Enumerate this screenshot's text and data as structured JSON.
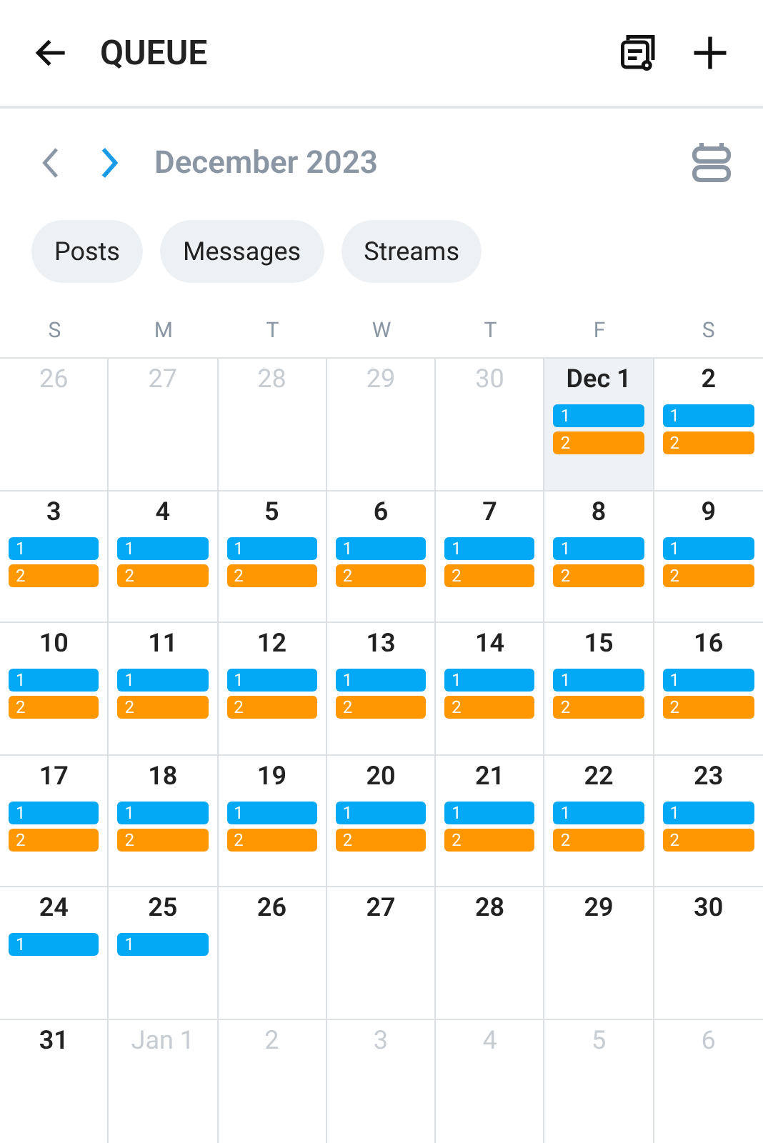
{
  "header": {
    "title": "QUEUE"
  },
  "nav": {
    "month": "December 2023"
  },
  "filters": [
    {
      "label": "Posts"
    },
    {
      "label": "Messages"
    },
    {
      "label": "Streams"
    }
  ],
  "weekdays": [
    "S",
    "M",
    "T",
    "W",
    "T",
    "F",
    "S"
  ],
  "weeks": [
    [
      {
        "label": "26",
        "outside": true,
        "selected": false
      },
      {
        "label": "27",
        "outside": true,
        "selected": false
      },
      {
        "label": "28",
        "outside": true,
        "selected": false
      },
      {
        "label": "29",
        "outside": true,
        "selected": false
      },
      {
        "label": "30",
        "outside": true,
        "selected": false
      },
      {
        "label": "Dec 1",
        "outside": false,
        "selected": true,
        "events": [
          {
            "label": "1",
            "color": "#03a9f4"
          },
          {
            "label": "2",
            "color": "#ff9800"
          }
        ]
      },
      {
        "label": "2",
        "outside": false,
        "selected": false,
        "events": [
          {
            "label": "1",
            "color": "#03a9f4"
          },
          {
            "label": "2",
            "color": "#ff9800"
          }
        ]
      }
    ],
    [
      {
        "label": "3",
        "outside": false,
        "selected": false,
        "events": [
          {
            "label": "1",
            "color": "#03a9f4"
          },
          {
            "label": "2",
            "color": "#ff9800"
          }
        ]
      },
      {
        "label": "4",
        "outside": false,
        "selected": false,
        "events": [
          {
            "label": "1",
            "color": "#03a9f4"
          },
          {
            "label": "2",
            "color": "#ff9800"
          }
        ]
      },
      {
        "label": "5",
        "outside": false,
        "selected": false,
        "events": [
          {
            "label": "1",
            "color": "#03a9f4"
          },
          {
            "label": "2",
            "color": "#ff9800"
          }
        ]
      },
      {
        "label": "6",
        "outside": false,
        "selected": false,
        "events": [
          {
            "label": "1",
            "color": "#03a9f4"
          },
          {
            "label": "2",
            "color": "#ff9800"
          }
        ]
      },
      {
        "label": "7",
        "outside": false,
        "selected": false,
        "events": [
          {
            "label": "1",
            "color": "#03a9f4"
          },
          {
            "label": "2",
            "color": "#ff9800"
          }
        ]
      },
      {
        "label": "8",
        "outside": false,
        "selected": false,
        "events": [
          {
            "label": "1",
            "color": "#03a9f4"
          },
          {
            "label": "2",
            "color": "#ff9800"
          }
        ]
      },
      {
        "label": "9",
        "outside": false,
        "selected": false,
        "events": [
          {
            "label": "1",
            "color": "#03a9f4"
          },
          {
            "label": "2",
            "color": "#ff9800"
          }
        ]
      }
    ],
    [
      {
        "label": "10",
        "outside": false,
        "selected": false,
        "events": [
          {
            "label": "1",
            "color": "#03a9f4"
          },
          {
            "label": "2",
            "color": "#ff9800"
          }
        ]
      },
      {
        "label": "11",
        "outside": false,
        "selected": false,
        "events": [
          {
            "label": "1",
            "color": "#03a9f4"
          },
          {
            "label": "2",
            "color": "#ff9800"
          }
        ]
      },
      {
        "label": "12",
        "outside": false,
        "selected": false,
        "events": [
          {
            "label": "1",
            "color": "#03a9f4"
          },
          {
            "label": "2",
            "color": "#ff9800"
          }
        ]
      },
      {
        "label": "13",
        "outside": false,
        "selected": false,
        "events": [
          {
            "label": "1",
            "color": "#03a9f4"
          },
          {
            "label": "2",
            "color": "#ff9800"
          }
        ]
      },
      {
        "label": "14",
        "outside": false,
        "selected": false,
        "events": [
          {
            "label": "1",
            "color": "#03a9f4"
          },
          {
            "label": "2",
            "color": "#ff9800"
          }
        ]
      },
      {
        "label": "15",
        "outside": false,
        "selected": false,
        "events": [
          {
            "label": "1",
            "color": "#03a9f4"
          },
          {
            "label": "2",
            "color": "#ff9800"
          }
        ]
      },
      {
        "label": "16",
        "outside": false,
        "selected": false,
        "events": [
          {
            "label": "1",
            "color": "#03a9f4"
          },
          {
            "label": "2",
            "color": "#ff9800"
          }
        ]
      }
    ],
    [
      {
        "label": "17",
        "outside": false,
        "selected": false,
        "events": [
          {
            "label": "1",
            "color": "#03a9f4"
          },
          {
            "label": "2",
            "color": "#ff9800"
          }
        ]
      },
      {
        "label": "18",
        "outside": false,
        "selected": false,
        "events": [
          {
            "label": "1",
            "color": "#03a9f4"
          },
          {
            "label": "2",
            "color": "#ff9800"
          }
        ]
      },
      {
        "label": "19",
        "outside": false,
        "selected": false,
        "events": [
          {
            "label": "1",
            "color": "#03a9f4"
          },
          {
            "label": "2",
            "color": "#ff9800"
          }
        ]
      },
      {
        "label": "20",
        "outside": false,
        "selected": false,
        "events": [
          {
            "label": "1",
            "color": "#03a9f4"
          },
          {
            "label": "2",
            "color": "#ff9800"
          }
        ]
      },
      {
        "label": "21",
        "outside": false,
        "selected": false,
        "events": [
          {
            "label": "1",
            "color": "#03a9f4"
          },
          {
            "label": "2",
            "color": "#ff9800"
          }
        ]
      },
      {
        "label": "22",
        "outside": false,
        "selected": false,
        "events": [
          {
            "label": "1",
            "color": "#03a9f4"
          },
          {
            "label": "2",
            "color": "#ff9800"
          }
        ]
      },
      {
        "label": "23",
        "outside": false,
        "selected": false,
        "events": [
          {
            "label": "1",
            "color": "#03a9f4"
          },
          {
            "label": "2",
            "color": "#ff9800"
          }
        ]
      }
    ],
    [
      {
        "label": "24",
        "outside": false,
        "selected": false,
        "events": [
          {
            "label": "1",
            "color": "#03a9f4"
          }
        ]
      },
      {
        "label": "25",
        "outside": false,
        "selected": false,
        "events": [
          {
            "label": "1",
            "color": "#03a9f4"
          }
        ]
      },
      {
        "label": "26",
        "outside": false,
        "selected": false
      },
      {
        "label": "27",
        "outside": false,
        "selected": false
      },
      {
        "label": "28",
        "outside": false,
        "selected": false
      },
      {
        "label": "29",
        "outside": false,
        "selected": false
      },
      {
        "label": "30",
        "outside": false,
        "selected": false
      }
    ],
    [
      {
        "label": "31",
        "outside": false,
        "selected": false
      },
      {
        "label": "Jan 1",
        "outside": true,
        "selected": false
      },
      {
        "label": "2",
        "outside": true,
        "selected": false
      },
      {
        "label": "3",
        "outside": true,
        "selected": false
      },
      {
        "label": "4",
        "outside": true,
        "selected": false
      },
      {
        "label": "5",
        "outside": true,
        "selected": false
      },
      {
        "label": "6",
        "outside": true,
        "selected": false
      }
    ]
  ]
}
